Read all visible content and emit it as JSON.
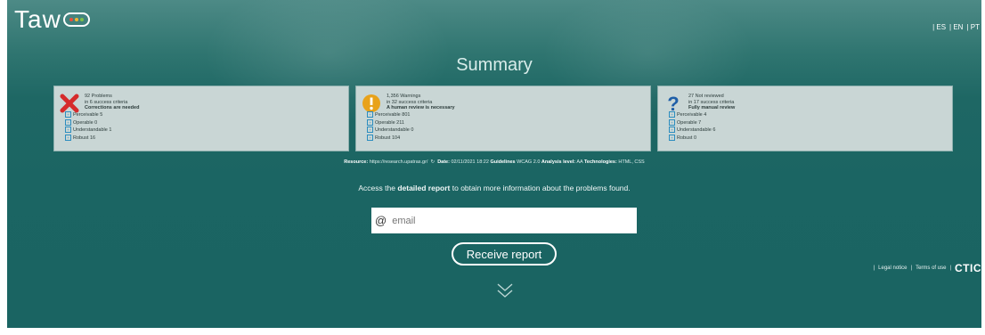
{
  "header": {
    "logo_text": "Taw",
    "languages": [
      "| ES",
      "| EN",
      "| PT"
    ]
  },
  "summary": {
    "title": "Summary",
    "cards": [
      {
        "icon": "error-x-icon",
        "color": "#d62b2b",
        "headline": "92 Problems",
        "sub": "in 6 success criteria",
        "note": "Corrections are needed",
        "items": [
          "Perceivable 5",
          "Operable 0",
          "Understandable 1",
          "Robust 16"
        ]
      },
      {
        "icon": "warning-icon",
        "color": "#e8a21a",
        "headline": "1,356 Warnings",
        "sub": "in 32 success criteria",
        "note": "A human review is necessary",
        "items": [
          "Perceivable 801",
          "Operable 211",
          "Understandable 0",
          "Robust 104"
        ]
      },
      {
        "icon": "question-icon",
        "color": "#1f5fa8",
        "headline": "27 Not reviewed",
        "sub": "in 17 success criteria",
        "note": "Fully manual review",
        "items": [
          "Perceivable 4",
          "Operable 7",
          "Understandable 6",
          "Robust 0"
        ]
      }
    ]
  },
  "resource": {
    "resource_label": "Resource:",
    "resource_url": "https://research.upatras.gr/",
    "date_label": "Date:",
    "date_value": "02/11/2021 18:22",
    "guidelines_label": "Guidelines",
    "guidelines_value": "WCAG 2.0",
    "level_label": "Analysis level:",
    "level_value": "AA",
    "tech_label": "Technologies:",
    "tech_value": "HTML, CSS"
  },
  "access": {
    "prefix": "Access the",
    "link": "detailed report",
    "suffix": "to obtain more information about the problems found."
  },
  "email": {
    "at_symbol": "@",
    "placeholder": "email"
  },
  "receive_button": "Receive report",
  "footer": {
    "legal": "Legal notice",
    "terms": "Terms of use",
    "brand": "CTIC"
  }
}
